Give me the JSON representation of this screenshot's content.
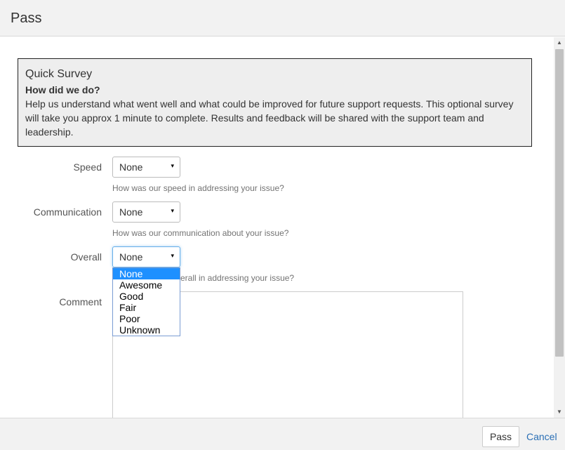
{
  "dialog": {
    "title": "Pass"
  },
  "survey": {
    "title": "Quick Survey",
    "subtitle": "How did we do?",
    "text_line1": "Help us understand what went well and what could be improved for future support requests. This optional survey",
    "text_line2": "will take you approx 1 minute to complete. Results and feedback will be shared with the support team and",
    "text_line3": "leadership."
  },
  "fields": {
    "speed": {
      "label": "Speed",
      "value": "None",
      "help": "How was our speed in addressing your issue?"
    },
    "communication": {
      "label": "Communication",
      "value": "None",
      "help": "How was our communication about your issue?"
    },
    "overall": {
      "label": "Overall",
      "value": "None",
      "help_visible": "erall in addressing your issue?"
    },
    "comment": {
      "label": "Comment",
      "value": ""
    }
  },
  "dropdown": {
    "options": [
      "None",
      "Awesome",
      "Good",
      "Fair",
      "Poor",
      "Unknown"
    ],
    "selected_index": 0
  },
  "footer": {
    "pass_label": "Pass",
    "cancel_label": "Cancel"
  },
  "icons": {
    "select_arrow": "▾",
    "scroll_up": "▲",
    "scroll_down": "▼"
  },
  "colors": {
    "highlight": "#1e90ff",
    "link": "#2a6fb5"
  }
}
